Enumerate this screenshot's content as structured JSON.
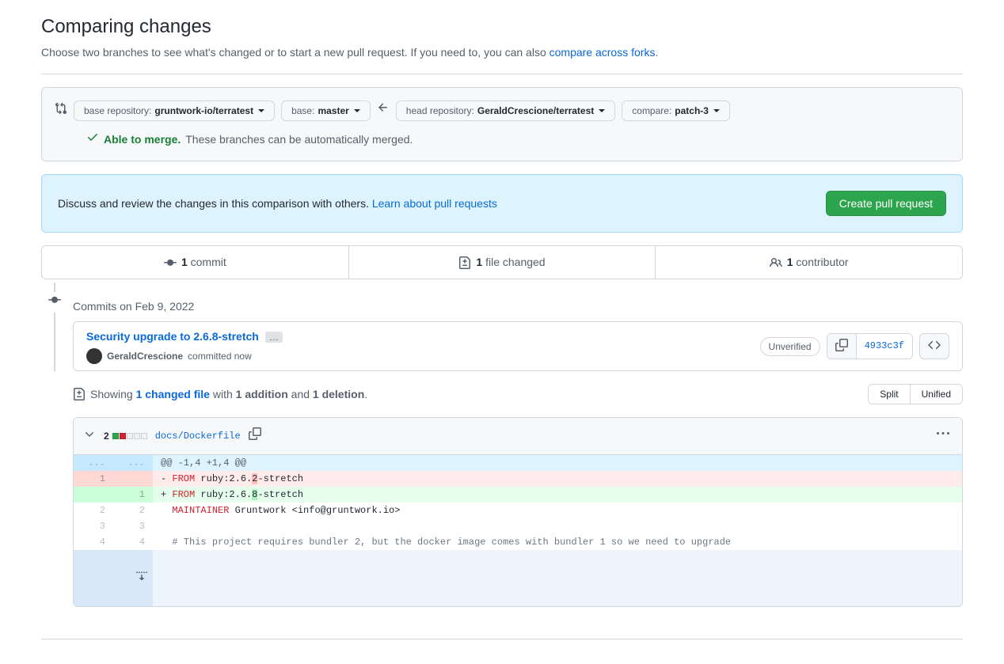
{
  "header": {
    "title": "Comparing changes",
    "subtitle_pre": "Choose two branches to see what's changed or to start a new pull request. If you need to, you can also ",
    "compare_forks_link": "compare across forks",
    "subtitle_post": "."
  },
  "range": {
    "base_repo_label": "base repository: ",
    "base_repo_value": "gruntwork-io/terratest",
    "base_label": "base: ",
    "base_value": "master",
    "head_repo_label": "head repository: ",
    "head_repo_value": "GeraldCrescione/terratest",
    "compare_label": "compare: ",
    "compare_value": "patch-3"
  },
  "merge": {
    "status": "Able to merge.",
    "detail": " These branches can be automatically merged."
  },
  "prompt": {
    "text": "Discuss and review the changes in this comparison with others. ",
    "learn_link": "Learn about pull requests",
    "create_btn": "Create pull request"
  },
  "stats": {
    "commits_n": "1",
    "commits_label": " commit",
    "files_n": "1",
    "files_label": " file changed",
    "contrib_n": "1",
    "contrib_label": " contributor"
  },
  "commits": {
    "date_label": "Commits on Feb 9, 2022",
    "title": "Security upgrade to 2.6.8-stretch",
    "author": "GeraldCrescione",
    "committed": " committed now",
    "unverified": "Unverified",
    "sha": "4933c3f"
  },
  "diff_summary": {
    "showing": "Showing ",
    "changed_file": "1 changed file",
    "with": " with ",
    "additions": "1 addition",
    "and": " and ",
    "deletions": "1 deletion",
    "period": ".",
    "split": "Split",
    "unified": "Unified"
  },
  "file": {
    "changes": "2",
    "name": "docs/Dockerfile"
  },
  "chart_data": {
    "type": "diff",
    "file": "docs/Dockerfile",
    "hunk": "@@ -1,4 +1,4 @@",
    "rows": [
      {
        "old": "1",
        "new": "",
        "type": "del",
        "content": "FROM ruby:2.6.2-stretch",
        "highlight": "2"
      },
      {
        "old": "",
        "new": "1",
        "type": "add",
        "content": "FROM ruby:2.6.8-stretch",
        "highlight": "8"
      },
      {
        "old": "2",
        "new": "2",
        "type": "ctx",
        "content": "MAINTAINER Gruntwork <info@gruntwork.io>"
      },
      {
        "old": "3",
        "new": "3",
        "type": "ctx",
        "content": ""
      },
      {
        "old": "4",
        "new": "4",
        "type": "ctx",
        "content": "# This project requires bundler 2, but the docker image comes with bundler 1 so we need to upgrade"
      }
    ]
  }
}
